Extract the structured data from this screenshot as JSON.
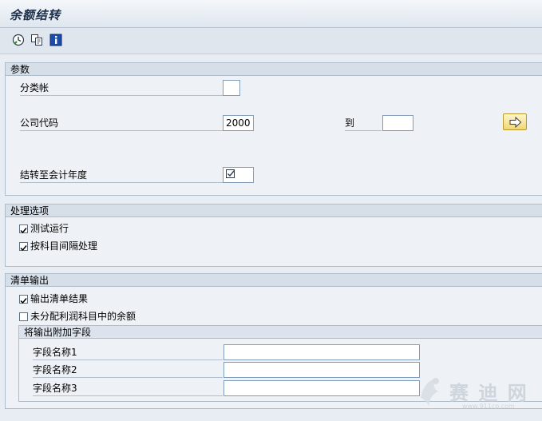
{
  "window": {
    "title": "余额结转"
  },
  "toolbar": {
    "icons": [
      "execute-icon",
      "copy-variant-icon",
      "info-icon"
    ]
  },
  "params": {
    "header": "参数",
    "ledger_label": "分类帐",
    "ledger_value": "",
    "company_label": "公司代码",
    "company_value": "2000",
    "to_label": "到",
    "company_to_value": "",
    "fiscal_year_label": "结转至会计年度",
    "fiscal_year_value": ""
  },
  "processing": {
    "header": "处理选项",
    "test_run_label": "测试运行",
    "test_run_checked": true,
    "by_account_interval_label": "按科目间隔处理",
    "by_account_interval_checked": true
  },
  "output": {
    "header": "清单输出",
    "output_result_label": "输出清单结果",
    "output_result_checked": true,
    "undistributed_label": "未分配利润科目中的余额",
    "undistributed_checked": false,
    "additional_header": "将输出附加字段",
    "fields": [
      {
        "label": "字段名称1",
        "value": ""
      },
      {
        "label": "字段名称2",
        "value": ""
      },
      {
        "label": "字段名称3",
        "value": ""
      }
    ]
  },
  "watermark": {
    "text": "赛 迪 网",
    "url_text": "www.911cp.com"
  }
}
